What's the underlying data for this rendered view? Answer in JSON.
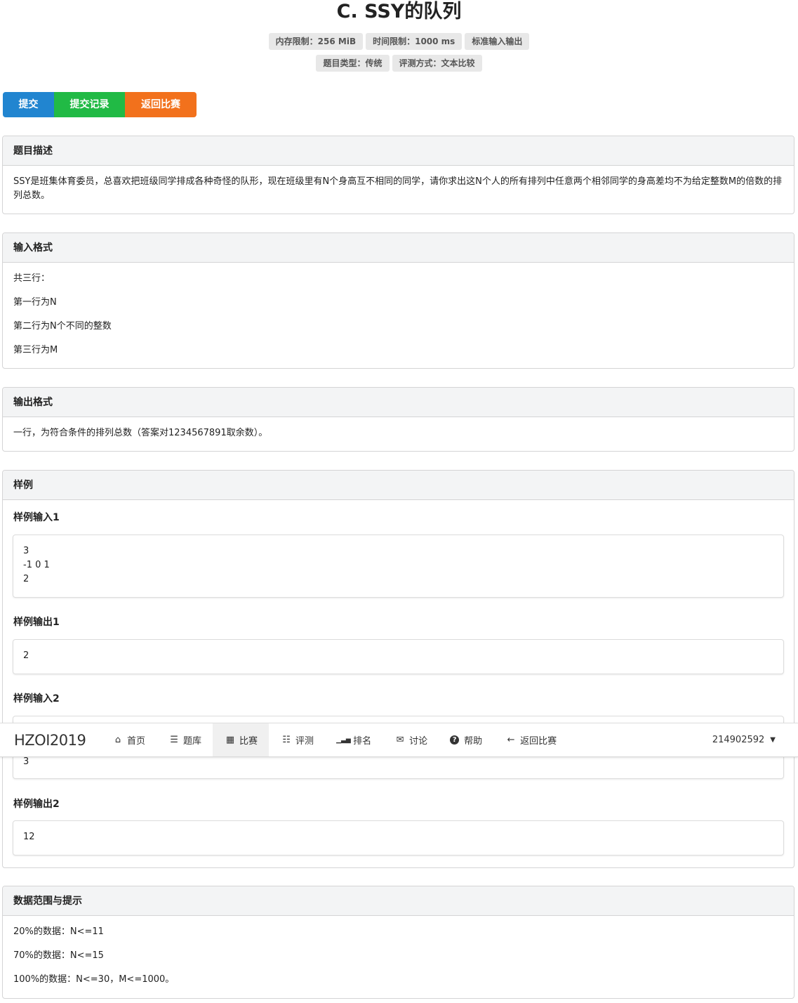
{
  "problem": {
    "title": "C. SSY的队列",
    "badges_row1": [
      "内存限制：256 MiB",
      "时间限制：1000 ms",
      "标准输入输出"
    ],
    "badges_row2": [
      "题目类型：传统",
      "评测方式：文本比较"
    ]
  },
  "actions": {
    "submit": "提交",
    "records": "提交记录",
    "back": "返回比赛"
  },
  "sections": {
    "description": {
      "header": "题目描述",
      "text": "SSY是班集体育委员，总喜欢把班级同学排成各种奇怪的队形，现在班级里有N个身高互不相同的同学，请你求出这N个人的所有排列中任意两个相邻同学的身高差均不为给定整数M的倍数的排列总数。"
    },
    "input": {
      "header": "输入格式",
      "lines": [
        "共三行：",
        "第一行为N",
        "第二行为N个不同的整数",
        "第三行为M"
      ]
    },
    "output": {
      "header": "输出格式",
      "text": "一行，为符合条件的排列总数（答案对1234567891取余数）。"
    },
    "samples": {
      "header": "样例",
      "input1_label": "样例输入1",
      "input1": "3\n-1 0 1\n2",
      "output1_label": "样例输出1",
      "output1": "2",
      "input2_label": "样例输入2",
      "input2_visible": "3",
      "output2_label": "样例输出2",
      "output2": "12"
    },
    "hints": {
      "header": "数据范围与提示",
      "lines": [
        "20%的数据：N<=11",
        "70%的数据：N<=15",
        "100%的数据：N<=30，M<=1000。"
      ]
    }
  },
  "navbar": {
    "brand": "HZOI2019",
    "items": [
      {
        "icon": "home-icon",
        "glyph": "⌂",
        "label": "首页"
      },
      {
        "icon": "list-icon",
        "glyph": "☰",
        "label": "题库"
      },
      {
        "icon": "calendar-icon",
        "glyph": "▦",
        "label": "比赛",
        "active": true
      },
      {
        "icon": "tasks-icon",
        "glyph": "☷",
        "label": "评测"
      },
      {
        "icon": "signal-icon",
        "glyph": "▁▃▅",
        "label": "排名"
      },
      {
        "icon": "comments-icon",
        "glyph": "✉",
        "label": "讨论"
      },
      {
        "icon": "question-icon",
        "glyph": "?",
        "label": "帮助"
      },
      {
        "icon": "arrow-left-icon",
        "glyph": "←",
        "label": "返回比赛"
      }
    ],
    "user": "214902592"
  },
  "colors": {
    "submit": "#2185d0",
    "records": "#21ba45",
    "back": "#f2711c"
  }
}
